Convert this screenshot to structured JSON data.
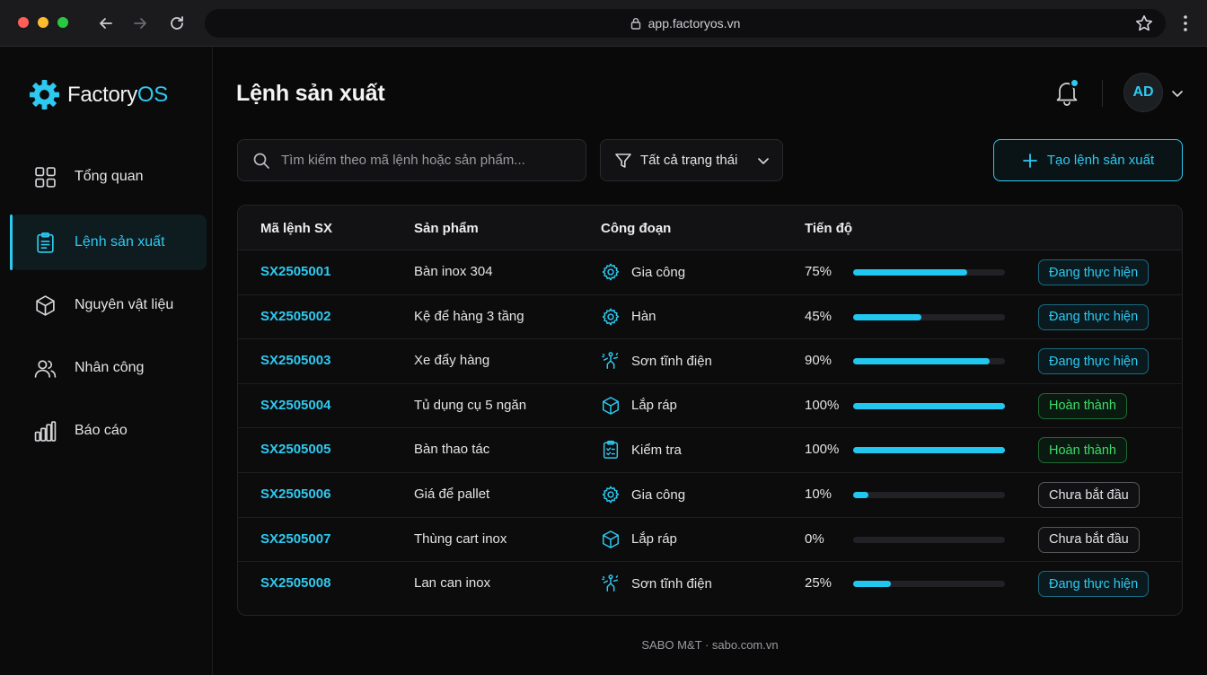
{
  "browser": {
    "url": "app.factoryos.vn"
  },
  "brand": {
    "name_prefix": "Factory",
    "name_suffix": "OS",
    "accent": "#2ec9f0"
  },
  "sidebar": {
    "items": [
      {
        "label": "Tổng quan",
        "icon": "grid-icon",
        "active": false
      },
      {
        "label": "Lệnh sản xuất",
        "icon": "clipboard-icon",
        "active": true
      },
      {
        "label": "Nguyên vật liệu",
        "icon": "box-icon",
        "active": false
      },
      {
        "label": "Nhân công",
        "icon": "users-icon",
        "active": false
      },
      {
        "label": "Báo cáo",
        "icon": "bar-chart-icon",
        "active": false
      }
    ]
  },
  "header": {
    "title": "Lệnh sản xuất",
    "avatar_initials": "AD"
  },
  "toolbar": {
    "search_placeholder": "Tìm kiếm theo mã lệnh hoặc sản phẩm...",
    "filter_label": "Tất cả trạng thái",
    "create_label": "Tạo lệnh sản xuất"
  },
  "table": {
    "columns": [
      "Mã lệnh SX",
      "Sản phẩm",
      "Công đoạn",
      "Tiến độ"
    ],
    "rows": [
      {
        "code": "SX2505001",
        "product": "Bàn inox 304",
        "stage": "Gia công",
        "stage_icon": "gear-icon",
        "progress": 75,
        "progress_label": "75%",
        "status": "Đang thực hiện",
        "status_type": "progress"
      },
      {
        "code": "SX2505002",
        "product": "Kệ để hàng 3 tầng",
        "stage": "Hàn",
        "stage_icon": "gear-icon",
        "progress": 45,
        "progress_label": "45%",
        "status": "Đang thực hiện",
        "status_type": "progress"
      },
      {
        "code": "SX2505003",
        "product": "Xe đẩy hàng",
        "stage": "Sơn tĩnh điện",
        "stage_icon": "spray-icon",
        "progress": 90,
        "progress_label": "90%",
        "status": "Đang thực hiện",
        "status_type": "progress"
      },
      {
        "code": "SX2505004",
        "product": "Tủ dụng cụ 5 ngăn",
        "stage": "Lắp ráp",
        "stage_icon": "box-icon",
        "progress": 100,
        "progress_label": "100%",
        "status": "Hoàn thành",
        "status_type": "done"
      },
      {
        "code": "SX2505005",
        "product": "Bàn thao tác",
        "stage": "Kiểm tra",
        "stage_icon": "checklist-icon",
        "progress": 100,
        "progress_label": "100%",
        "status": "Hoàn thành",
        "status_type": "done"
      },
      {
        "code": "SX2505006",
        "product": "Giá để pallet",
        "stage": "Gia công",
        "stage_icon": "gear-icon",
        "progress": 10,
        "progress_label": "10%",
        "status": "Chưa bắt đầu",
        "status_type": "pending"
      },
      {
        "code": "SX2505007",
        "product": "Thùng cart inox",
        "stage": "Lắp ráp",
        "stage_icon": "box-icon",
        "progress": 0,
        "progress_label": "0%",
        "status": "Chưa bắt đầu",
        "status_type": "pending"
      },
      {
        "code": "SX2505008",
        "product": "Lan can inox",
        "stage": "Sơn tĩnh điện",
        "stage_icon": "spray-icon",
        "progress": 25,
        "progress_label": "25%",
        "status": "Đang thực hiện",
        "status_type": "progress"
      }
    ]
  },
  "footer": {
    "text": "SABO M&T · sabo.com.vn"
  }
}
